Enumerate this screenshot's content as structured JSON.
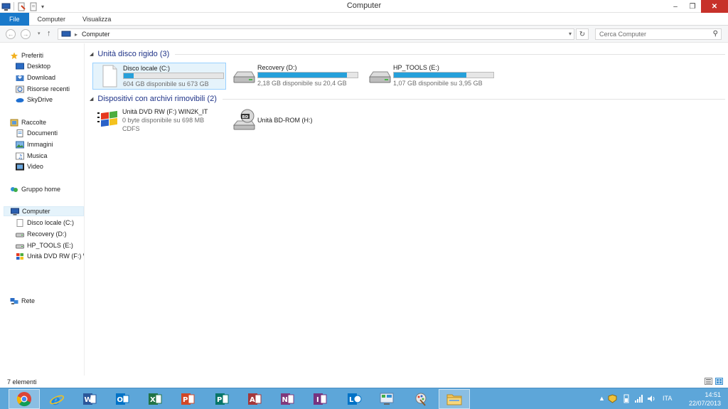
{
  "window": {
    "title": "Computer"
  },
  "ribbon": {
    "tabs": [
      "File",
      "Computer",
      "Visualizza"
    ]
  },
  "address": {
    "path": "Computer",
    "search_placeholder": "Cerca Computer"
  },
  "nav": {
    "favorites_header": "Preferiti",
    "favorites": [
      "Desktop",
      "Download",
      "Risorse recenti",
      "SkyDrive"
    ],
    "libraries_header": "Raccolte",
    "libraries": [
      "Documenti",
      "Immagini",
      "Musica",
      "Video"
    ],
    "homegroup": "Gruppo home",
    "computer": "Computer",
    "drives": [
      "Disco locale (C:)",
      "Recovery (D:)",
      "HP_TOOLS (E:)",
      "Unità DVD RW (F:) W"
    ],
    "network": "Rete"
  },
  "content": {
    "hdd_group": "Unità disco rigido (3)",
    "hdd": [
      {
        "name": "Disco locale (C:)",
        "info": "604 GB disponibile su 673 GB",
        "used": 0.1
      },
      {
        "name": "Recovery (D:)",
        "info": "2,18 GB disponibile su 20,4 GB",
        "used": 0.89
      },
      {
        "name": "HP_TOOLS (E:)",
        "info": "1,07 GB disponibile su 3,95 GB",
        "used": 0.73
      }
    ],
    "removable_group": "Dispositivi con archivi rimovibili (2)",
    "removable": [
      {
        "name": "Unità DVD RW (F:) WIN2K_IT",
        "info": "0 byte disponibile su 698 MB",
        "fs": "CDFS"
      },
      {
        "name": "Unità BD-ROM (H:)"
      }
    ]
  },
  "status": {
    "items_count": "7 elementi"
  },
  "taskbar": {
    "apps": [
      "chrome-icon",
      "internet-explorer-icon",
      "word-icon",
      "outlook-icon",
      "excel-icon",
      "powerpoint-icon",
      "publisher-icon",
      "access-icon",
      "onenote-icon",
      "infopath-icon",
      "lync-icon",
      "control-panel-icon",
      "paint-icon",
      "file-explorer-icon"
    ],
    "language": "ITA",
    "time": "14:51",
    "date": "22/07/2013"
  },
  "colors": {
    "accent": "#1979ca",
    "taskbar": "#5da6d9",
    "bar_fill": "#26a0da",
    "group_title": "#1e3287"
  }
}
